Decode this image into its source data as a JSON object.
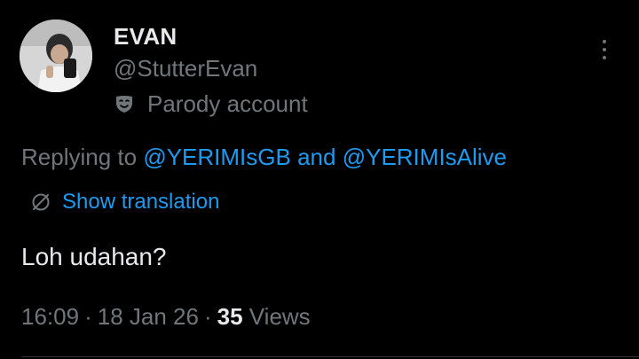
{
  "author": {
    "display_name": "EVAN",
    "handle": "@StutterEvan",
    "label_icon": "parody-mask-icon",
    "label_text": "Parody account"
  },
  "reply": {
    "prefix": "Replying to",
    "mention_1": "@YERIMIsGB",
    "conjunction": "and",
    "mention_2": "@YERIMIsAlive"
  },
  "translation": {
    "icon": "globe-icon",
    "label": "Show translation"
  },
  "tweet": {
    "text": "Loh udahan?"
  },
  "meta": {
    "time": "16:09",
    "separator": "·",
    "date": "18 Jan 26",
    "views_count": "35",
    "views_label": "Views"
  },
  "icons": {
    "more": "more-dots-icon"
  },
  "colors": {
    "background": "#000000",
    "text_primary": "#e7e9ea",
    "text_secondary": "#71767b",
    "link": "#1d9bf0"
  }
}
